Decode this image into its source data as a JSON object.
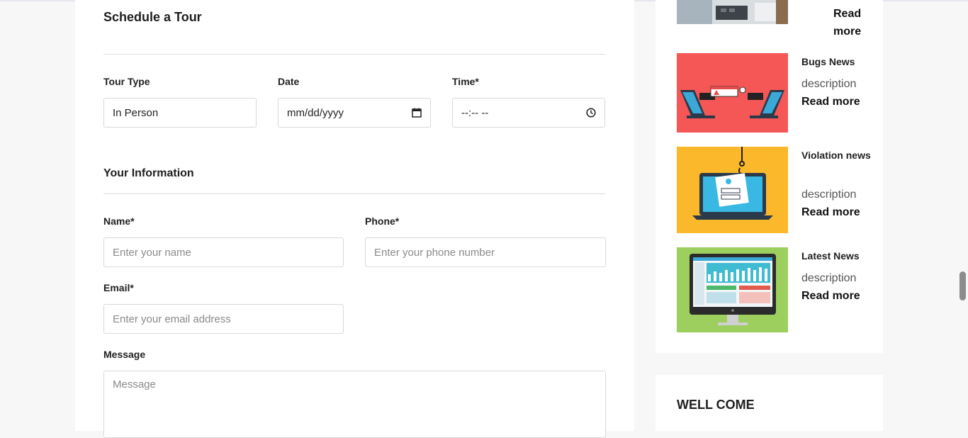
{
  "schedule": {
    "title": "Schedule a Tour",
    "tour_type": {
      "label": "Tour Type",
      "value": "In Person"
    },
    "date": {
      "label": "Date",
      "value": "mm/dd/yyyy"
    },
    "time": {
      "label": "Time*",
      "value": "--:-- --"
    }
  },
  "info": {
    "title": "Your Information",
    "name": {
      "label": "Name*",
      "placeholder": "Enter your name"
    },
    "phone": {
      "label": "Phone*",
      "placeholder": "Enter your phone number"
    },
    "email": {
      "label": "Email*",
      "placeholder": "Enter your email address"
    },
    "message": {
      "label": "Message",
      "placeholder": "Message"
    }
  },
  "sidebar": {
    "partial_item": {
      "read_more": "Read more"
    },
    "news": [
      {
        "title": "Bugs News",
        "description": "description",
        "read_more": "Read more",
        "image": "bug-error-illustration"
      },
      {
        "title": "Violation news",
        "description": "description",
        "read_more": "Read more",
        "image": "phishing-laptop-illustration"
      },
      {
        "title": "Latest News",
        "description": "description",
        "read_more": "Read more",
        "image": "dashboard-monitor-illustration"
      }
    ],
    "welcome": "WELL COME"
  },
  "colors": {
    "bug_bg": "#f55656",
    "violation_bg": "#fbb82a",
    "latest_bg": "#9ccf5e"
  }
}
